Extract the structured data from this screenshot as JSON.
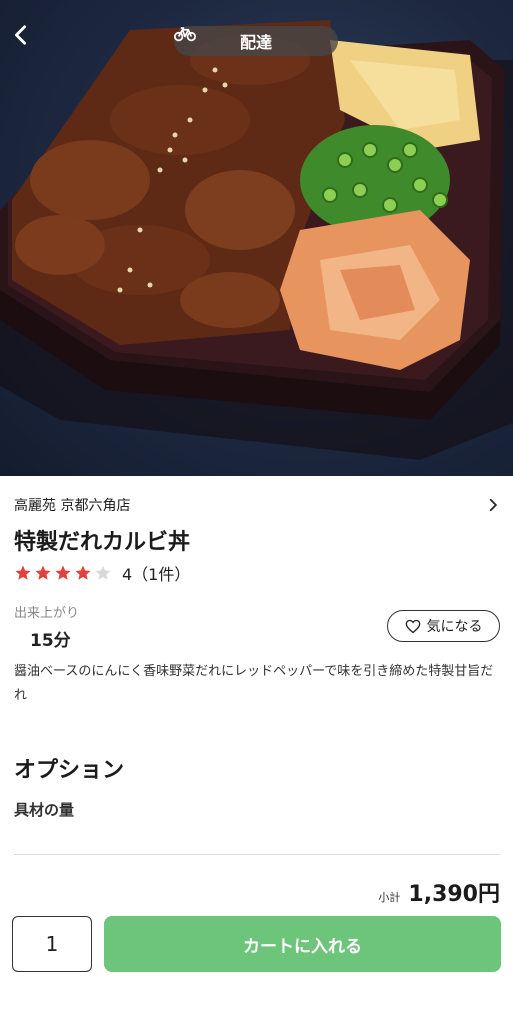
{
  "header": {
    "delivery_label": "配達"
  },
  "item": {
    "store_name": "高麗苑 京都六角店",
    "title": "特製だれカルビ丼",
    "rating_value": 4,
    "rating_max": 5,
    "rating_text": "4（1件）",
    "time_label": "出来上がり",
    "time_value": "15分",
    "favorite_label": "気になる",
    "description": "醤油ベースのにんにく香味野菜だれにレッドペッパーで味を引き締めた特製甘旨だれ"
  },
  "options": {
    "heading": "オプション",
    "sub_label": "具材の量"
  },
  "footer": {
    "subtotal_label": "小計",
    "subtotal_value": "1,390円",
    "quantity": "1",
    "cart_button": "カートに入れる"
  },
  "colors": {
    "star_active": "#e23f3f",
    "star_inactive": "#d9d9d9",
    "cart_button": "#6cc57a"
  },
  "icons": {
    "back": "chevron-left-icon",
    "delivery": "bicycle-icon",
    "store_link": "chevron-right-icon",
    "favorite": "heart-icon",
    "rating": "star-icon"
  }
}
